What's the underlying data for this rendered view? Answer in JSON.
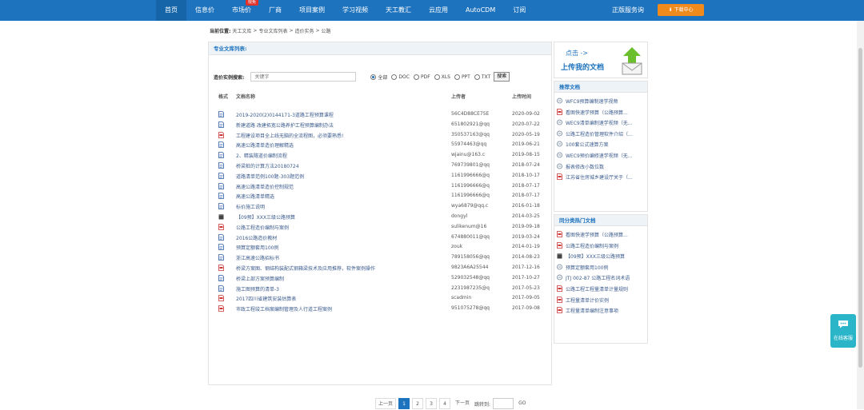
{
  "nav": {
    "items": [
      {
        "label": "首页",
        "active": true
      },
      {
        "label": "信息价"
      },
      {
        "label": "市场价",
        "badge": "限免"
      },
      {
        "label": "厂商"
      },
      {
        "label": "项目案例"
      },
      {
        "label": "学习视频"
      },
      {
        "label": "天工教汇"
      },
      {
        "label": "云应用"
      },
      {
        "label": "AutoCDM"
      },
      {
        "label": "订阅"
      }
    ],
    "extra": "正版服务询",
    "download": "下载中心"
  },
  "breadcrumb": {
    "label": "当前位置:",
    "items": [
      "天工文库",
      "专业文库列表",
      "造价实务",
      "公路"
    ]
  },
  "main": {
    "header": "专业文库列表:",
    "search_label": "造价实例搜索:",
    "search_placeholder": "关键字",
    "filters": [
      {
        "label": "全部",
        "checked": true
      },
      {
        "label": "DOC"
      },
      {
        "label": "PDF"
      },
      {
        "label": "XLS"
      },
      {
        "label": "PPT"
      },
      {
        "label": "TXT"
      }
    ],
    "search_button": "搜索",
    "columns": {
      "format": "格式",
      "name": "文档名称",
      "uploader": "上传者",
      "time": "上传时间"
    },
    "rows": [
      {
        "icon": "doc",
        "title": "2019-2020(2)0144171-3道路工程预算课程",
        "user": "56C4D88CE75E",
        "date": "2020-09-02"
      },
      {
        "icon": "doc",
        "title": "新建道路 改建拓宽公路养护工程预算编制办法",
        "user": "651802921@qq",
        "date": "2020-07-22"
      },
      {
        "icon": "pdf",
        "title": "工程建设项目全上线无脑的全流程图，必须要熟悉!",
        "user": "350537163@qq",
        "date": "2020-05-19"
      },
      {
        "icon": "doc",
        "title": "高速公路清单造价理解精选",
        "user": "55974463@qq",
        "date": "2019-06-21"
      },
      {
        "icon": "doc",
        "title": "2、精装隧道价编制流程",
        "user": "wjainu@163.c",
        "date": "2019-08-15"
      },
      {
        "icon": "doc",
        "title": "桥梁桩的计算方法20180724",
        "user": "769739801@qq",
        "date": "2018-07-24"
      },
      {
        "icon": "doc",
        "title": "道路清单范例100题-303题范例",
        "user": "1161996666@q",
        "date": "2018-10-17"
      },
      {
        "icon": "doc",
        "title": "高速公路清单造价控制规范",
        "user": "1161996666@q",
        "date": "2018-07-17"
      },
      {
        "icon": "doc",
        "title": "高速公路清单精选",
        "user": "1161996666@q",
        "date": "2018-07-17"
      },
      {
        "icon": "doc",
        "title": "标价施工说明",
        "user": "wya6879@qq.c",
        "date": "2016-01-18"
      },
      {
        "icon": "rar",
        "title": "【09预】XXX三级公路预算",
        "user": "dongyl",
        "date": "2014-03-25"
      },
      {
        "icon": "pdf",
        "title": "公路工程造价编制与案例",
        "user": "sulikenum@16",
        "date": "2019-09-18"
      },
      {
        "icon": "doc",
        "title": "2016公路造价教材",
        "user": "674880011@qq",
        "date": "2019-03-24"
      },
      {
        "icon": "doc",
        "title": "预算定额套用100例",
        "user": "zouk",
        "date": "2014-01-19"
      },
      {
        "icon": "doc",
        "title": "浙江高速公路招标书",
        "user": "789158056@qq",
        "date": "2014-08-23"
      },
      {
        "icon": "pdf",
        "title": "桥梁方案图、钢结构装配式钢箱梁技术及应用推荐，软件案例操作",
        "user": "9823A6A25544",
        "date": "2017-12-16"
      },
      {
        "icon": "doc",
        "title": "桥梁上部方案预算编制",
        "user": "529032548@qq",
        "date": "2017-10-27"
      },
      {
        "icon": "doc",
        "title": "施工图预算的清单-3",
        "user": "2231987235@q",
        "date": "2017-05-23"
      },
      {
        "icon": "pdf",
        "title": "2017四川省建筑安装估算表",
        "user": "scadmin",
        "date": "2017-09-05"
      },
      {
        "icon": "pdf",
        "title": "市政工程竣工档案编制管理及人行道工程案例",
        "user": "951075278@qq",
        "date": "2017-09-08"
      }
    ]
  },
  "pager": {
    "prev": "上一页",
    "pages": [
      "1",
      "2",
      "3",
      "4"
    ],
    "current": "1",
    "next": "下一页",
    "jump_label": "跳转到:",
    "go": "GO"
  },
  "upload": {
    "click": "点击 ->",
    "text": "上传我的文档"
  },
  "recommended": {
    "title": "推荐文档",
    "items": [
      {
        "icon": "link",
        "title": "WFC9预算编制速学视频"
      },
      {
        "icon": "pdf",
        "title": "看图快速学预算（公路预算..."
      },
      {
        "icon": "link",
        "title": "WEC9清单编制速学视频（无..."
      },
      {
        "icon": "link",
        "title": "公路工程造价管理软件介绍（..."
      },
      {
        "icon": "link",
        "title": "100套公式速算方案"
      },
      {
        "icon": "link",
        "title": "WEC9预价编修速学视频（无..."
      },
      {
        "icon": "link",
        "title": "报表修改小数位数"
      },
      {
        "icon": "pdf",
        "title": "江苏省住房城乡建设厅关于（..."
      }
    ]
  },
  "hot": {
    "title": "同分类热门文档",
    "items": [
      {
        "icon": "pdf",
        "title": "看图快速学预算（公路预算..."
      },
      {
        "icon": "pdf",
        "title": "公路工程造价编制与案例"
      },
      {
        "icon": "rar",
        "title": "【09预】XXX三级公路预算"
      },
      {
        "icon": "link",
        "title": "预算定额套用100例"
      },
      {
        "icon": "link",
        "title": "JTJ 002-87 公路工程名词术语"
      },
      {
        "icon": "pdf",
        "title": "公路工程工程量清单计量规则"
      },
      {
        "icon": "pdf",
        "title": "工程量清单计价实例"
      },
      {
        "icon": "pdf",
        "title": "工程量清单编制注意事项"
      }
    ]
  },
  "chat": {
    "label": "在线客服"
  },
  "colors": {
    "nav": "#1e73be",
    "accent": "#f08a1d",
    "chat": "#2bb5c9",
    "link": "#3a5a8c"
  }
}
